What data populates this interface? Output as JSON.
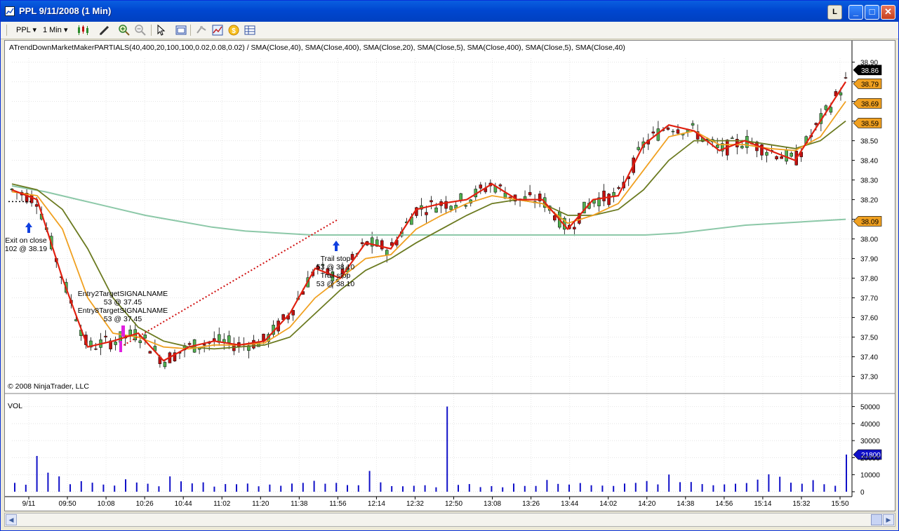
{
  "window": {
    "title": "PPL  9/11/2008 (1 Min)",
    "buttons": {
      "link": "L",
      "minimize": "_",
      "maximize": "□",
      "close": "✕"
    }
  },
  "toolbar": {
    "instrument": "PPL",
    "interval": "1 Min",
    "icons": [
      "candlestick-icon",
      "draw-pencil-icon",
      "zoom-in-icon",
      "zoom-out-icon",
      "pointer-icon",
      "properties-icon",
      "strategy-icon",
      "chart-style-icon",
      "alert-icon",
      "data-box-icon"
    ]
  },
  "chart": {
    "indicator_label": "ATrendDownMarketMakerPARTIALS(40,400,20,100,100,0.02,0.08,0.02) / SMA(Close,40), SMA(Close,400), SMA(Close,20), SMA(Close,5), SMA(Close,400), SMA(Close,5), SMA(Close,40)",
    "copyright": "© 2008 NinjaTrader, LLC",
    "volume_label": "VOL",
    "colors": {
      "sma5": "#e02010",
      "sma20": "#f0a020",
      "sma40": "#6b7a20",
      "sma400": "#8cc8a8",
      "volume": "#1010c8",
      "candle_up": "#50b050",
      "candle_down": "#c01010",
      "trade_line": "#d01010",
      "entry_arrow": "#e020e0",
      "exit_arrow": "#1040e0"
    }
  },
  "chart_data": [
    {
      "type": "line",
      "title": "",
      "y_axis": {
        "ticks": [
          "38.90",
          "38.80",
          "38.70",
          "38.60",
          "38.50",
          "38.40",
          "38.30",
          "38.20",
          "38.10",
          "38.00",
          "37.90",
          "37.80",
          "37.70",
          "37.60",
          "37.50",
          "37.40",
          "37.30"
        ],
        "ylim": [
          37.27,
          38.92
        ]
      },
      "x_axis": {
        "ticks": [
          "9/11",
          "09:50",
          "10:08",
          "10:26",
          "10:44",
          "11:02",
          "11:20",
          "11:38",
          "11:56",
          "12:14",
          "12:32",
          "12:50",
          "13:08",
          "13:26",
          "13:44",
          "14:02",
          "14:20",
          "14:38",
          "14:56",
          "15:14",
          "15:32",
          "15:50"
        ]
      },
      "price_markers": [
        {
          "label": "38.86",
          "style": "dark"
        },
        {
          "label": "38.79",
          "style": "orange"
        },
        {
          "label": "38.69",
          "style": "orange"
        },
        {
          "label": "38.59",
          "style": "orange"
        },
        {
          "label": "38.09",
          "style": "orange"
        }
      ],
      "series": [
        {
          "name": "SMA(Close,5)",
          "values": [
            38.25,
            38.2,
            37.8,
            37.45,
            37.48,
            37.52,
            37.38,
            37.45,
            37.48,
            37.46,
            37.48,
            37.62,
            37.85,
            37.8,
            37.98,
            37.95,
            38.15,
            38.18,
            38.2,
            38.28,
            38.2,
            38.2,
            38.05,
            38.2,
            38.22,
            38.48,
            38.58,
            38.55,
            38.45,
            38.5,
            38.45,
            38.4,
            38.6,
            38.8
          ]
        },
        {
          "name": "SMA(Close,20)",
          "values": [
            38.24,
            38.22,
            38.05,
            37.7,
            37.52,
            37.5,
            37.45,
            37.44,
            37.46,
            37.46,
            37.47,
            37.55,
            37.7,
            37.8,
            37.9,
            37.92,
            38.05,
            38.12,
            38.18,
            38.22,
            38.2,
            38.18,
            38.08,
            38.12,
            38.18,
            38.35,
            38.52,
            38.55,
            38.48,
            38.48,
            38.46,
            38.45,
            38.52,
            38.7
          ]
        },
        {
          "name": "SMA(Close,40)",
          "values": [
            38.28,
            38.25,
            38.15,
            37.95,
            37.7,
            37.55,
            37.48,
            37.45,
            37.44,
            37.45,
            37.46,
            37.5,
            37.62,
            37.74,
            37.84,
            37.9,
            37.98,
            38.05,
            38.12,
            38.18,
            38.2,
            38.18,
            38.12,
            38.12,
            38.15,
            38.25,
            38.4,
            38.5,
            38.5,
            38.5,
            38.48,
            38.46,
            38.5,
            38.6
          ]
        },
        {
          "name": "SMA(Close,400)",
          "values": [
            38.27,
            38.24,
            38.2,
            38.16,
            38.12,
            38.09,
            38.06,
            38.04,
            38.03,
            38.02,
            38.02,
            38.02,
            38.02,
            38.02,
            38.02,
            38.02,
            38.02,
            38.02,
            38.02,
            38.02,
            38.03,
            38.05,
            38.07,
            38.08,
            38.09,
            38.1
          ]
        }
      ],
      "annotations": [
        {
          "text": "Exit on close"
        },
        {
          "text": "102 @ 38.19"
        },
        {
          "text": "Entry2TargetSIGNALNAME"
        },
        {
          "text": "53 @ 37.45"
        },
        {
          "text": "Entry8TargetSIGNALNAME"
        },
        {
          "text": "53 @ 37.45"
        },
        {
          "text": "Trail stop"
        },
        {
          "text": "53 @ 38.10"
        },
        {
          "text": "Trail stop"
        },
        {
          "text": "53 @ 38.10"
        }
      ]
    },
    {
      "type": "bar",
      "title": "",
      "name": "VOL",
      "y_axis": {
        "ticks": [
          "50000",
          "40000",
          "30000",
          "20000",
          "10000",
          "0"
        ],
        "ylim": [
          0,
          56000
        ]
      },
      "last_value_marker": "21800",
      "values": [
        5200,
        4100,
        21000,
        11200,
        9000,
        4400,
        6200,
        5300,
        4200,
        3600,
        7300,
        5400,
        4700,
        3200,
        9000,
        6100,
        4900,
        5500,
        3000,
        4500,
        4400,
        4800,
        3200,
        4200,
        3500,
        4800,
        5200,
        6400,
        4700,
        5200,
        3900,
        3800,
        12200,
        5500,
        3300,
        3200,
        3500,
        3800,
        2600,
        50000,
        4000,
        4500,
        2700,
        3300,
        2600,
        4800,
        3400,
        3400,
        6900,
        4600,
        4200,
        5100,
        3800,
        3600,
        3400,
        4800,
        5200,
        6300,
        4300,
        10100,
        5600,
        5700,
        4500,
        3800,
        4300,
        4700,
        5100,
        7100,
        10200,
        8800,
        5300,
        4700,
        6800,
        4400,
        3500,
        21800
      ]
    }
  ]
}
